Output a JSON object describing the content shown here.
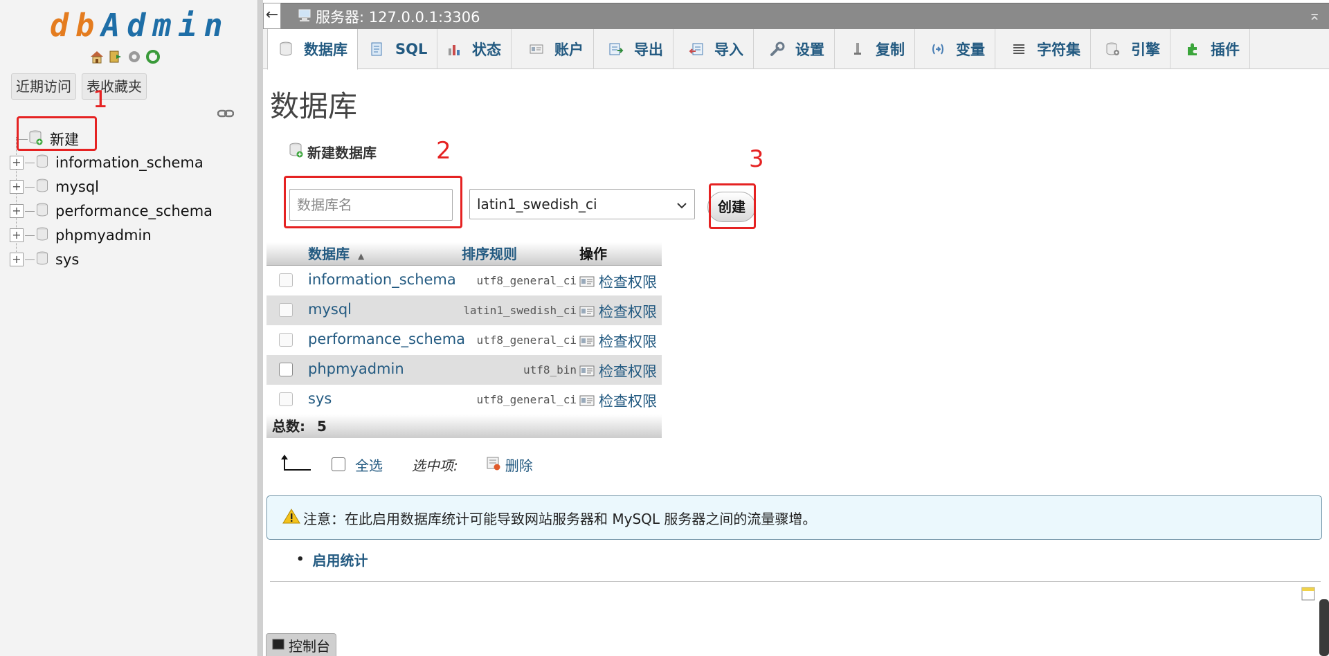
{
  "logo": {
    "part1": "db",
    "part2": "Admin"
  },
  "sidebar": {
    "tabs": {
      "recent": "近期访问",
      "favorites": "表收藏夹"
    },
    "new_label": "新建",
    "databases": [
      "information_schema",
      "mysql",
      "performance_schema",
      "phpmyadmin",
      "sys"
    ],
    "expand_glyph": "+"
  },
  "topbar": {
    "collapse_glyph": "←",
    "server_title": "服务器: 127.0.0.1:3306",
    "right_glyph": "⌅"
  },
  "menu": {
    "tabs": [
      {
        "label": "数据库",
        "icon": "database-icon"
      },
      {
        "label": "SQL",
        "icon": "sql-icon"
      },
      {
        "label": "状态",
        "icon": "status-icon"
      },
      {
        "label": "账户",
        "icon": "accounts-icon"
      },
      {
        "label": "导出",
        "icon": "export-icon"
      },
      {
        "label": "导入",
        "icon": "import-icon"
      },
      {
        "label": "设置",
        "icon": "wrench-icon"
      },
      {
        "label": "复制",
        "icon": "replication-icon"
      },
      {
        "label": "变量",
        "icon": "variables-icon"
      },
      {
        "label": "字符集",
        "icon": "charset-icon"
      },
      {
        "label": "引擎",
        "icon": "engine-icon"
      },
      {
        "label": "插件",
        "icon": "plugin-icon"
      }
    ]
  },
  "main": {
    "page_title": "数据库",
    "create_heading": "新建数据库",
    "db_name_placeholder": "数据库名",
    "collation_selected": "latin1_swedish_ci",
    "create_button": "创建",
    "annotations": [
      "1",
      "2",
      "3"
    ]
  },
  "table": {
    "headers": {
      "database": "数据库",
      "collation": "排序规则",
      "action": "操作"
    },
    "rows": [
      {
        "name": "information_schema",
        "collation": "utf8_general_ci",
        "action": "检查权限"
      },
      {
        "name": "mysql",
        "collation": "latin1_swedish_ci",
        "action": "检查权限"
      },
      {
        "name": "performance_schema",
        "collation": "utf8_general_ci",
        "action": "检查权限"
      },
      {
        "name": "phpmyadmin",
        "collation": "utf8_bin",
        "action": "检查权限"
      },
      {
        "name": "sys",
        "collation": "utf8_general_ci",
        "action": "检查权限"
      }
    ],
    "total_label": "总数:",
    "total_value": "5"
  },
  "bulk": {
    "select_all": "全选",
    "with_selected": "选中项:",
    "delete": "删除"
  },
  "notice": {
    "text": "注意：在此启用数据库统计可能导致网站服务器和 MySQL 服务器之间的流量骤增。"
  },
  "enable_stats": "启用统计",
  "console": {
    "label": "控制台"
  },
  "colors": {
    "link": "#235a81",
    "annotation": "#e52222",
    "logo_orange": "#e47c1f",
    "logo_blue": "#1e6ea7"
  }
}
